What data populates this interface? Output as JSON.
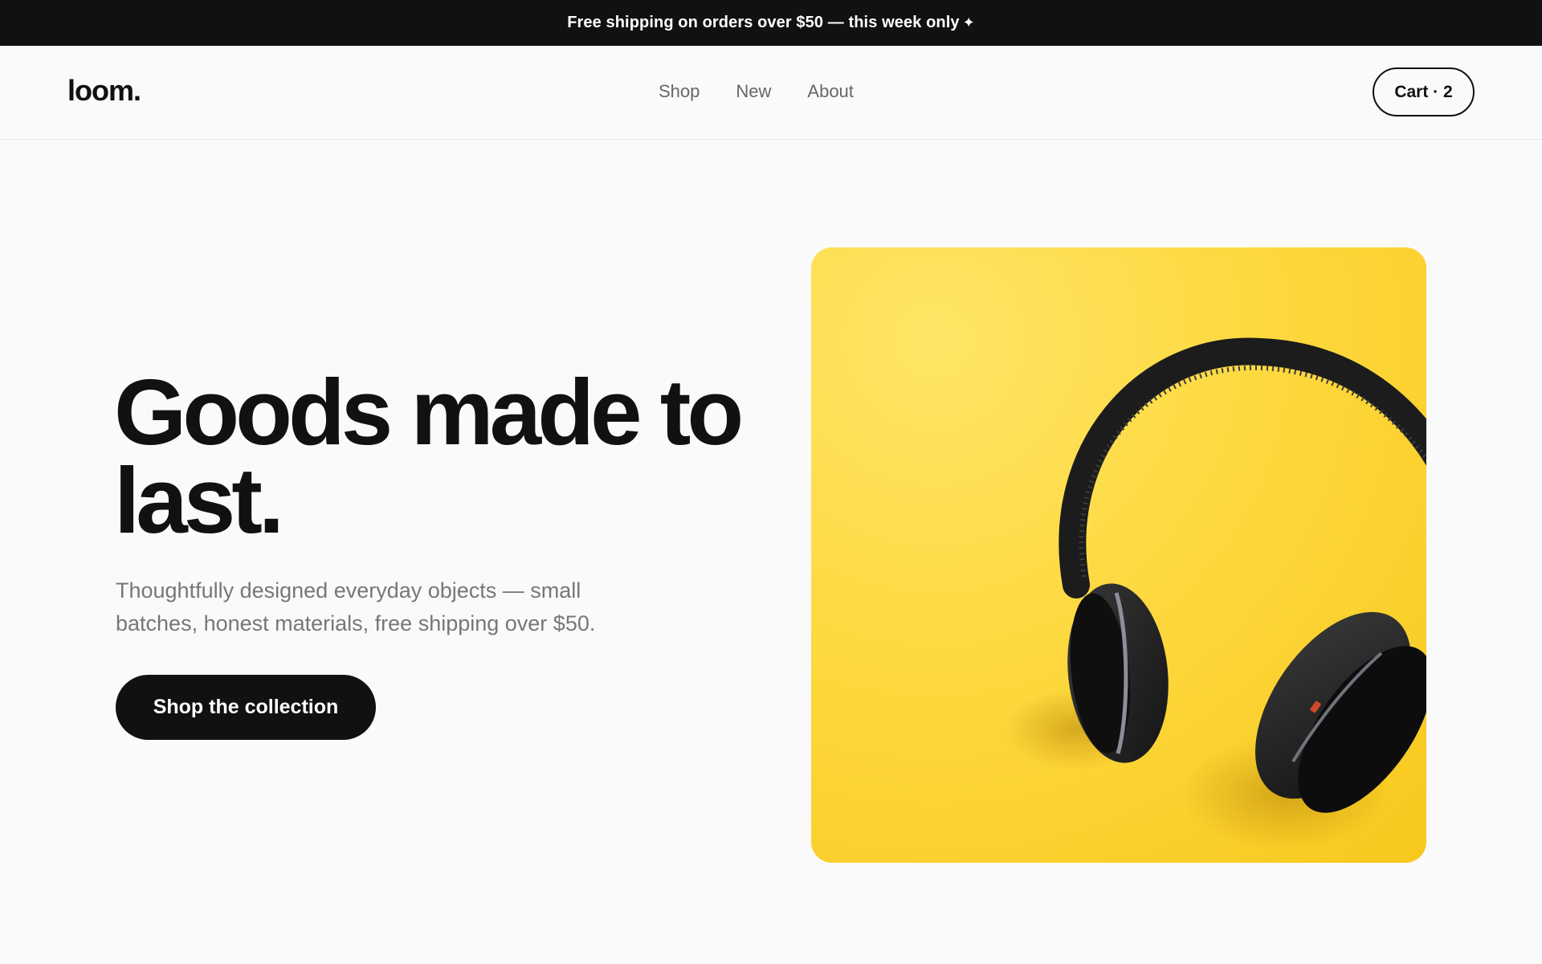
{
  "announcement": {
    "text": "Free shipping on orders over $50 — this week only",
    "icon": "sparkle-icon"
  },
  "header": {
    "logo": "loom.",
    "nav": [
      {
        "label": "Shop"
      },
      {
        "label": "New"
      },
      {
        "label": "About"
      }
    ],
    "cart_label": "Cart · 2"
  },
  "hero": {
    "title_line1": "Goods made to",
    "title_line2": "last.",
    "subtitle_line1": "Thoughtfully designed everyday objects — small",
    "subtitle_line2": "batches, honest materials, free shipping over $50.",
    "cta_label": "Shop the collection",
    "image": {
      "subject": "headphones-image",
      "background_color": "#fdd940",
      "accent_color": "#111111"
    }
  },
  "colors": {
    "page_bg": "#fafafa",
    "text_primary": "#111111",
    "text_muted": "#777777",
    "announcement_bg": "#111111"
  }
}
